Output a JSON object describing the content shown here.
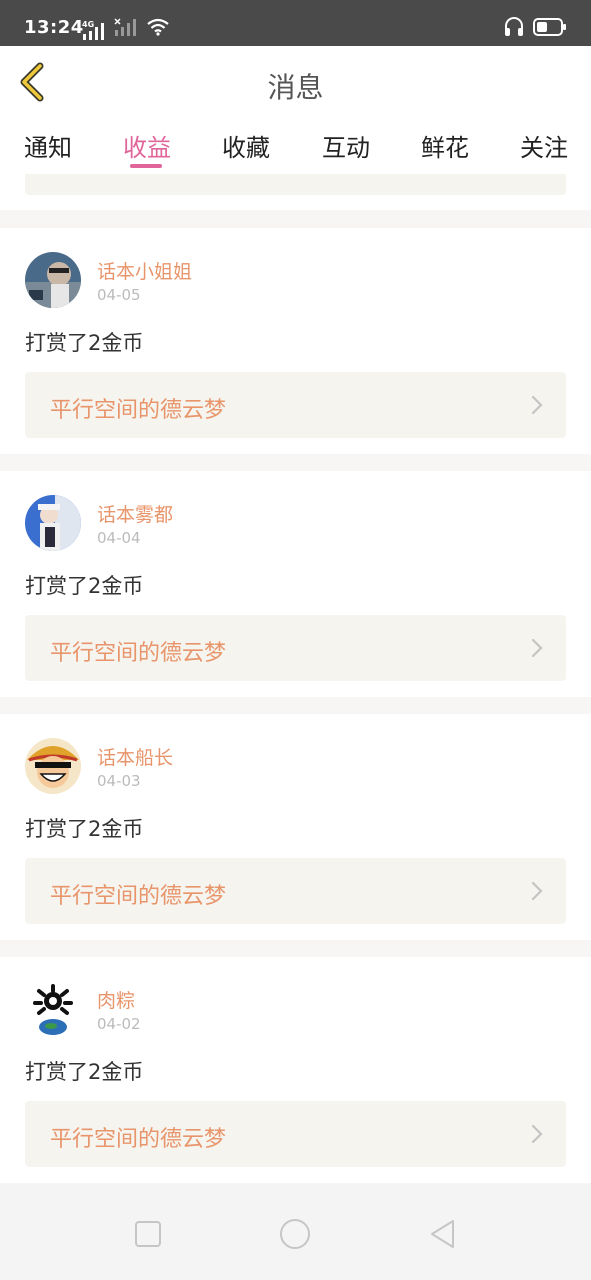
{
  "status_bar": {
    "time": "13:24",
    "network_label": "4G",
    "icons": [
      "signal-icon",
      "no-sim-signal-icon",
      "wifi-icon",
      "headphones-icon",
      "battery-icon"
    ]
  },
  "header": {
    "title": "消息",
    "back_icon": "chevron-left-icon"
  },
  "tabs": [
    {
      "label": "通知",
      "active": false
    },
    {
      "label": "收益",
      "active": true
    },
    {
      "label": "收藏",
      "active": false
    },
    {
      "label": "互动",
      "active": false
    },
    {
      "label": "鲜花",
      "active": false
    },
    {
      "label": "关注",
      "active": false
    }
  ],
  "colors": {
    "accent": "#e0659a",
    "name": "#e8956b",
    "card_bg": "#f5f4ee"
  },
  "messages": [
    {
      "user": "话本小姐姐",
      "date": "04-05",
      "action": "打赏了2金币",
      "work_title": "平行空间的德云梦"
    },
    {
      "user": "话本雾都",
      "date": "04-04",
      "action": "打赏了2金币",
      "work_title": "平行空间的德云梦"
    },
    {
      "user": "话本船长",
      "date": "04-03",
      "action": "打赏了2金币",
      "work_title": "平行空间的德云梦"
    },
    {
      "user": "肉粽",
      "date": "04-02",
      "action": "打赏了2金币",
      "work_title": "平行空间的德云梦"
    }
  ],
  "nav_bar": {
    "icons": [
      "square-recent-apps-icon",
      "circle-home-icon",
      "triangle-back-icon"
    ]
  }
}
